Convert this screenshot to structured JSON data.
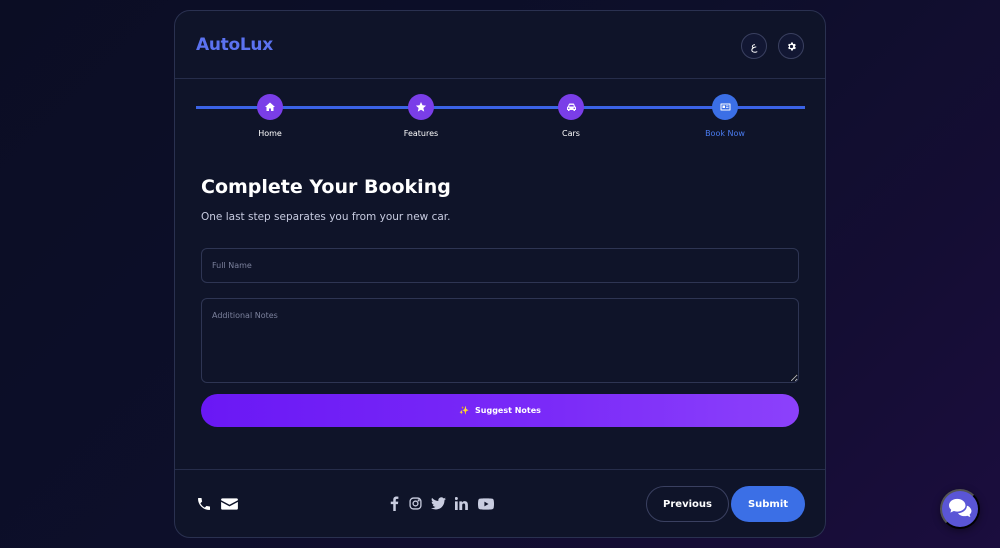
{
  "header": {
    "logo": "AutoLux",
    "lang_label": "ع",
    "theme_icon": "gear-icon"
  },
  "steps": [
    {
      "label": "Home",
      "icon": "home-icon",
      "active": false
    },
    {
      "label": "Features",
      "icon": "star-icon",
      "active": false
    },
    {
      "label": "Cars",
      "icon": "car-icon",
      "active": false
    },
    {
      "label": "Book Now",
      "icon": "id-card-icon",
      "active": true
    }
  ],
  "form": {
    "title": "Complete Your Booking",
    "subtitle": "One last step separates you from your new car.",
    "name_placeholder": "Full Name",
    "notes_placeholder": "Additional Notes",
    "suggest_label": "Suggest Notes",
    "suggest_icon": "✨"
  },
  "footer": {
    "contact_icons": [
      "phone-icon",
      "envelope-icon"
    ],
    "social_icons": [
      "facebook-icon",
      "instagram-icon",
      "twitter-icon",
      "linkedin-icon",
      "youtube-icon"
    ],
    "prev_label": "Previous",
    "submit_label": "Submit"
  },
  "colors": {
    "accent_blue": "#3b6fe6",
    "accent_purple": "#7a3ee8",
    "logo": "#5b72f0",
    "card_bg": "#0f1429"
  }
}
